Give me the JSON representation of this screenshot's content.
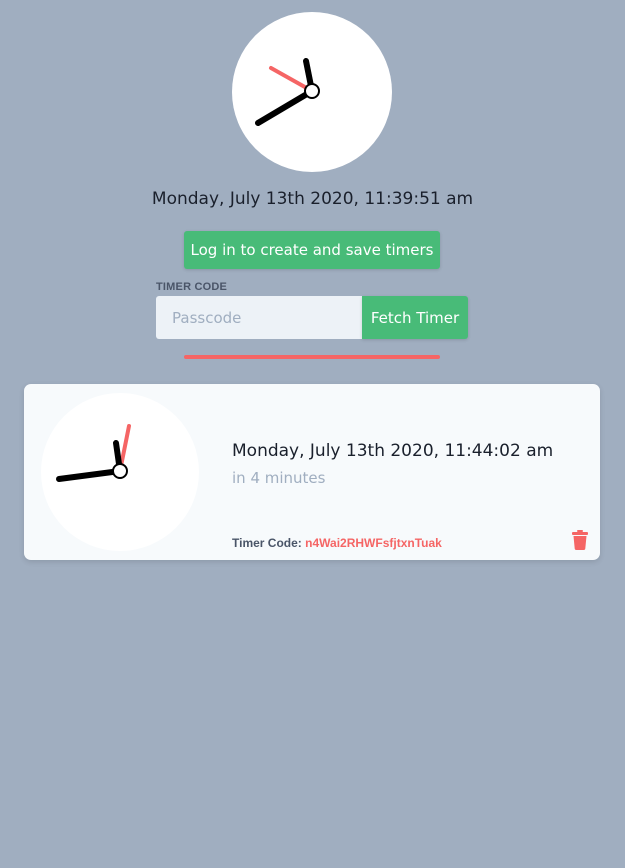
{
  "header": {
    "current_datetime": "Monday, July 13th 2020, 11:39:51 am",
    "login_button_label": "Log in to create and save timers"
  },
  "fetch_form": {
    "label": "TIMER CODE",
    "placeholder": "Passcode",
    "value": "",
    "fetch_button_label": "Fetch Timer"
  },
  "timer": {
    "datetime": "Monday, July 13th 2020, 11:44:02 am",
    "relative": "in 4 minutes",
    "code_label": "Timer Code:",
    "code_value": "n4Wai2RHWFsfjtxnTuak",
    "delete_icon": "trash-icon"
  },
  "colors": {
    "background": "#a0aec0",
    "accent_green": "#48bb78",
    "accent_red": "#f56565",
    "card_background": "#f7fafc"
  }
}
